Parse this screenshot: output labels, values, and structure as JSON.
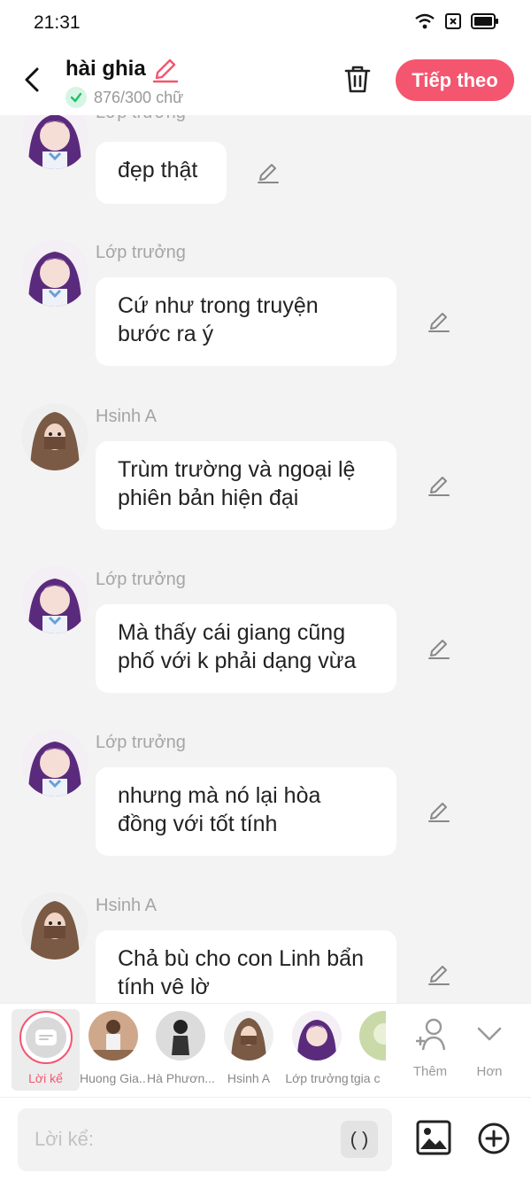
{
  "status": {
    "time": "21:31"
  },
  "header": {
    "title": "hài ghia",
    "word_count": "876/300 chữ",
    "next_label": "Tiếp theo"
  },
  "messages": [
    {
      "sender": "Lớp trưởng",
      "text": "đẹp thật",
      "avatar": "purple-girl"
    },
    {
      "sender": "Lớp trưởng",
      "text": "Cứ như trong truyện bước ra ý",
      "avatar": "purple-girl"
    },
    {
      "sender": "Hsinh A",
      "text": "Trùm trường và ngoại lệ phiên bản hiện đại",
      "avatar": "hooded"
    },
    {
      "sender": "Lớp trưởng",
      "text": "Mà thấy cái giang cũng phố với k phải dạng vừa",
      "avatar": "purple-girl"
    },
    {
      "sender": "Lớp trưởng",
      "text": "nhưng mà nó lại hòa đồng với tốt tính",
      "avatar": "purple-girl"
    },
    {
      "sender": "Hsinh A",
      "text": "Chả bù cho con Linh bẩn tính vê lờ",
      "avatar": "hooded"
    }
  ],
  "characters": [
    {
      "label": "Lời kể",
      "selected": true
    },
    {
      "label": "Huong Gia..."
    },
    {
      "label": "Hà Phươn..."
    },
    {
      "label": "Hsinh A"
    },
    {
      "label": "Lớp trưởng"
    },
    {
      "label": "tgia c"
    }
  ],
  "toolbar": {
    "add_label": "Thêm",
    "more_label": "Hơn"
  },
  "input": {
    "placeholder": "Lời kể:",
    "paren": "( )"
  },
  "colors": {
    "accent": "#f4556f",
    "bubble": "#ffffff",
    "background": "#f3f3f3"
  }
}
